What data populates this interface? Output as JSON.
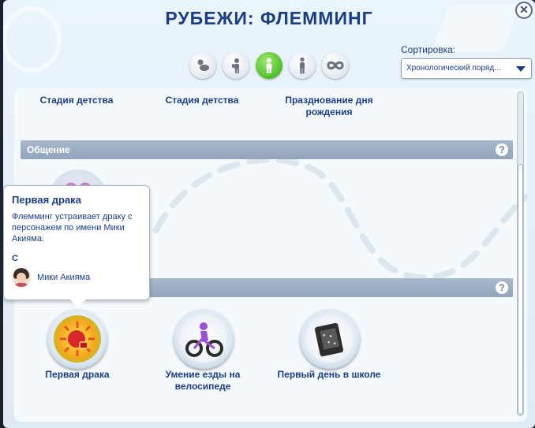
{
  "window": {
    "title": "РУБЕЖИ: ФЛЕММИНГ",
    "close_symbol": "✕"
  },
  "filters": [
    {
      "icon": "baby-icon",
      "active": false
    },
    {
      "icon": "toddler-icon",
      "active": false
    },
    {
      "icon": "child-icon",
      "active": true
    },
    {
      "icon": "teen-icon",
      "active": false
    },
    {
      "icon": "infinity-icon",
      "active": false
    }
  ],
  "sort": {
    "label": "Сортировка:",
    "value": "Хронологический поряд..."
  },
  "top_row": {
    "items": [
      {
        "label": "Стадия детства"
      },
      {
        "label": "Стадия детства"
      },
      {
        "label": "Празднование дня рождения"
      }
    ]
  },
  "sections": [
    {
      "title": "Общение",
      "help": "?"
    },
    {
      "title": "",
      "help": "?"
    }
  ],
  "milestones": [
    {
      "label": "Первая драка",
      "icon": "fight-icon"
    },
    {
      "label": "Умение езды на велосипеде",
      "icon": "bicycle-icon"
    },
    {
      "label": "Первый день в школе",
      "icon": "school-notebook-icon"
    }
  ],
  "tooltip": {
    "title": "Первая драка",
    "description": "Флемминг устраивает драку с персонажем по имени Мики Акияма.",
    "with_label": "С",
    "person_name": "Мики Акияма"
  },
  "colors": {
    "accent_dark_blue": "#1b3d86",
    "active_filter_green": "#4fbf2b",
    "section_bar": "#9aaac0",
    "panel_bg": "#f4f9fd"
  }
}
